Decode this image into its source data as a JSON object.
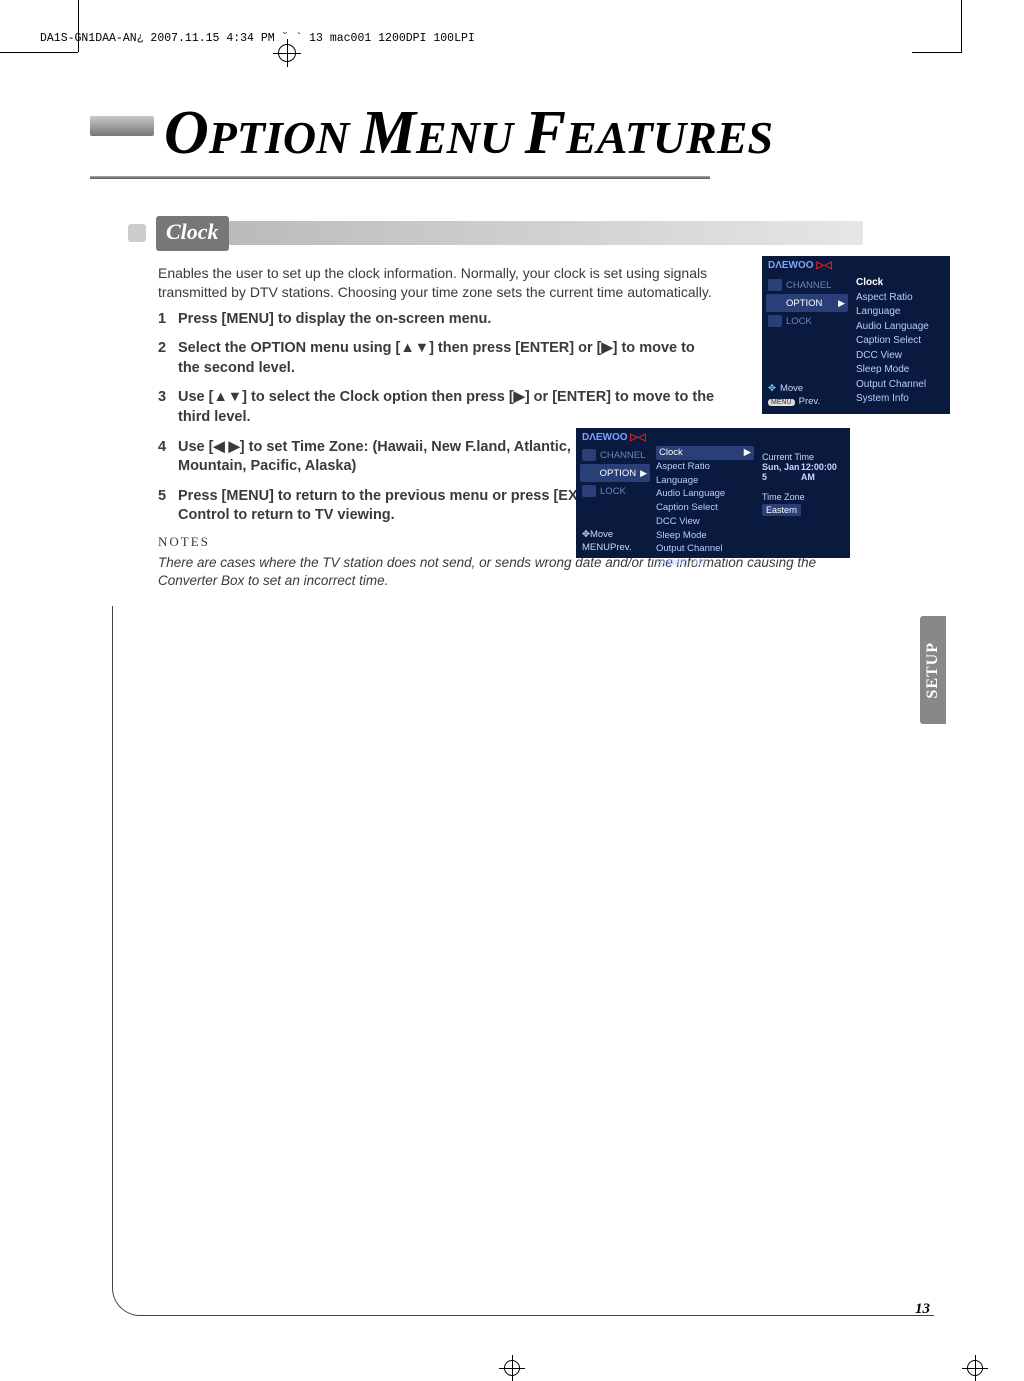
{
  "header_line": "DA1S-GN1DAA-AN¿  2007.11.15 4:34 PM  ˘ ` 13   mac001  1200DPI 100LPI",
  "title_parts": {
    "w1_big": "O",
    "w1_small": "PTION ",
    "w2_big": "M",
    "w2_small": "ENU ",
    "w3_big": "F",
    "w3_small": "EATURES"
  },
  "section_label": "Clock",
  "intro": "Enables the user to set up the clock information. Normally, your clock is set using signals transmitted by DTV stations. Choosing your time zone sets the current time automatically.",
  "steps": [
    "Press [MENU] to display the on-screen menu.",
    "Select the OPTION menu using [▲▼] then press [ENTER] or [▶] to move to the second level.",
    "Use [▲▼] to select the Clock option then press [▶] or [ENTER] to move to the third level.",
    "Use [◀ ▶] to set Time Zone: (Hawaii, New F.land, Atlantic, Eastern, Central, Mountain, Pacific, Alaska)",
    "Press [MENU] to return to the previous menu or press [EXIT] on the Remote Control to return to TV viewing."
  ],
  "notes_label": "NOTES",
  "notes_text": "There are cases where the TV station does not send, or sends wrong date and/or time information causing the Converter Box to set an incorrect time.",
  "osd_brand": "DΛEWOO",
  "osd_brand_suffix": " ▷◁",
  "osd1": {
    "menu": {
      "channel": "CHANNEL",
      "option": "OPTION",
      "lock": "LOCK"
    },
    "items": [
      "Clock",
      "Aspect Ratio",
      "Language",
      "Audio Language",
      "Caption Select",
      "DCC View",
      "Sleep Mode",
      "Output Channel",
      "System Info"
    ],
    "move": "Move",
    "prev": "Prev.",
    "menu_pill": "MENU"
  },
  "osd2": {
    "menu": {
      "channel": "CHANNEL",
      "option": "OPTION",
      "lock": "LOCK"
    },
    "items": [
      "Clock",
      "Aspect Ratio",
      "Language",
      "Audio Language",
      "Caption Select",
      "DCC View",
      "Sleep Mode",
      "Output Channel",
      "System Info"
    ],
    "ct_label": "Current Time",
    "ct_date": "Sun, Jan 5",
    "ct_time": "12:00:00 AM",
    "tz_label": "Time Zone",
    "tz_value": "Eastern",
    "move": "Move",
    "prev": "Prev.",
    "menu_pill": "MENU"
  },
  "side_tab": "SETUP",
  "page_number": "13"
}
